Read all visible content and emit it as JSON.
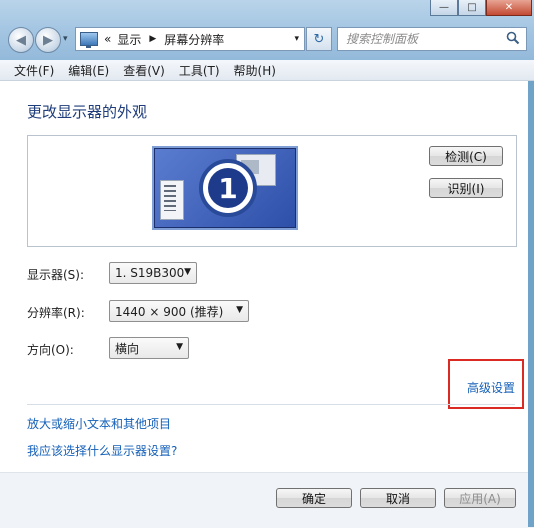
{
  "window": {
    "minimize_glyph": "—",
    "maximize_glyph": "□",
    "close_glyph": "✕"
  },
  "nav": {
    "back_glyph": "◀",
    "forward_glyph": "▶",
    "history_glyph": "▾"
  },
  "address": {
    "prefix": "«",
    "crumbs": [
      "显示",
      "屏幕分辨率"
    ],
    "separator": "▶",
    "dropdown_glyph": "▾",
    "refresh_glyph": "↻"
  },
  "search": {
    "placeholder": "搜索控制面板"
  },
  "menu": {
    "items": [
      "文件(F)",
      "编辑(E)",
      "查看(V)",
      "工具(T)",
      "帮助(H)"
    ]
  },
  "main": {
    "title": "更改显示器的外观",
    "monitor_number": "1",
    "detect_button": "检测(C)",
    "identify_button": "识别(I)",
    "display_label": "显示器(S):",
    "display_value": "1. S19B300",
    "resolution_label": "分辨率(R):",
    "resolution_value": "1440 × 900 (推荐)",
    "orientation_label": "方向(O):",
    "orientation_value": "横向",
    "advanced_link": "高级设置",
    "link_text_size": "放大或缩小文本和其他项目",
    "link_which_settings": "我应该选择什么显示器设置?"
  },
  "footer": {
    "ok_button": "确定",
    "cancel_button": "取消",
    "apply_button": "应用(A)"
  },
  "colors": {
    "highlight_box": "#d92b23",
    "link": "#1560b8",
    "heading": "#1f3d7a"
  }
}
